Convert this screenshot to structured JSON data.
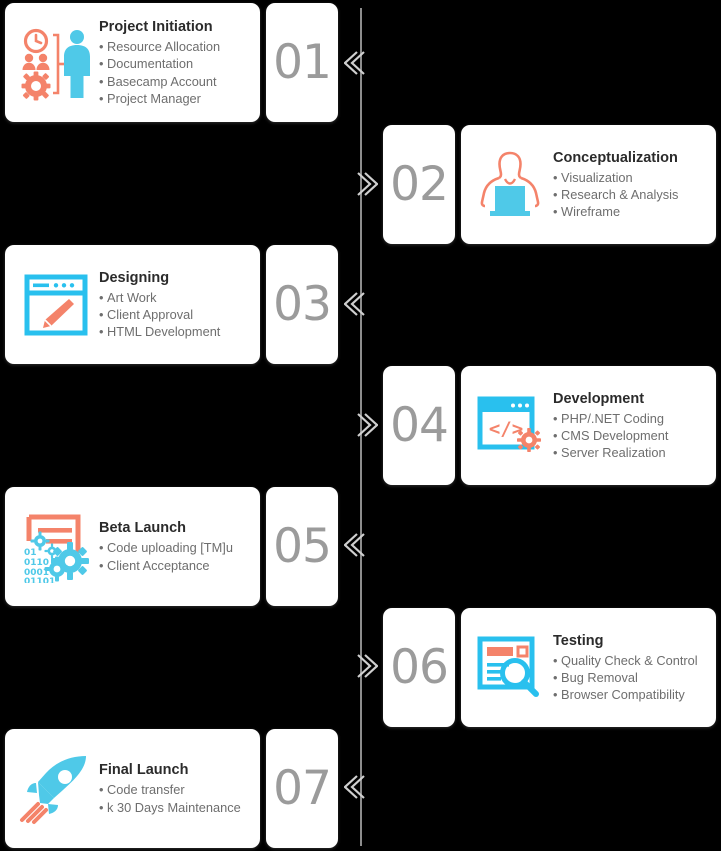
{
  "colors": {
    "orange": "#F4836A",
    "blue": "#4FC9E8",
    "number": "#9B9B9B",
    "title": "#2B2B2B",
    "bullet": "#6E6E6E",
    "background": "#000000",
    "card": "#FFFFFF",
    "timeline": "#8D8D8D"
  },
  "steps": [
    {
      "number": "01",
      "title": "Project Initiation",
      "side": "left",
      "icon": "project-initiation-icon",
      "bullets": [
        "Resource Allocation",
        "Documentation",
        "Basecamp Account",
        "Project Manager"
      ]
    },
    {
      "number": "02",
      "title": "Conceptualization",
      "side": "right",
      "icon": "conceptualization-icon",
      "bullets": [
        "Visualization",
        "Research & Analysis",
        "Wireframe"
      ]
    },
    {
      "number": "03",
      "title": "Designing",
      "side": "left",
      "icon": "designing-icon",
      "bullets": [
        "Art Work",
        "Client Approval",
        "HTML Development"
      ]
    },
    {
      "number": "04",
      "title": "Development",
      "side": "right",
      "icon": "development-icon",
      "bullets": [
        "PHP/.NET Coding",
        "CMS Development",
        "Server Realization"
      ]
    },
    {
      "number": "05",
      "title": "Beta Launch",
      "side": "left",
      "icon": "beta-launch-icon",
      "bullets": [
        "Code uploading [TM]u",
        "Client Acceptance"
      ]
    },
    {
      "number": "06",
      "title": "Testing",
      "side": "right",
      "icon": "testing-icon",
      "bullets": [
        "Quality Check & Control",
        "Bug Removal",
        "Browser Compatibility"
      ]
    },
    {
      "number": "07",
      "title": "Final Launch",
      "side": "left",
      "icon": "final-launch-icon",
      "bullets": [
        "Code transfer",
        "k 30 Days Maintenance"
      ]
    }
  ],
  "connectors": [
    {
      "direction": "left",
      "icon": "chevron-double-left-icon"
    },
    {
      "direction": "right",
      "icon": "chevron-double-right-icon"
    },
    {
      "direction": "left",
      "icon": "chevron-double-left-icon"
    },
    {
      "direction": "right",
      "icon": "chevron-double-right-icon"
    },
    {
      "direction": "left",
      "icon": "chevron-double-left-icon"
    },
    {
      "direction": "right",
      "icon": "chevron-double-right-icon"
    },
    {
      "direction": "left",
      "icon": "chevron-double-left-icon"
    }
  ]
}
